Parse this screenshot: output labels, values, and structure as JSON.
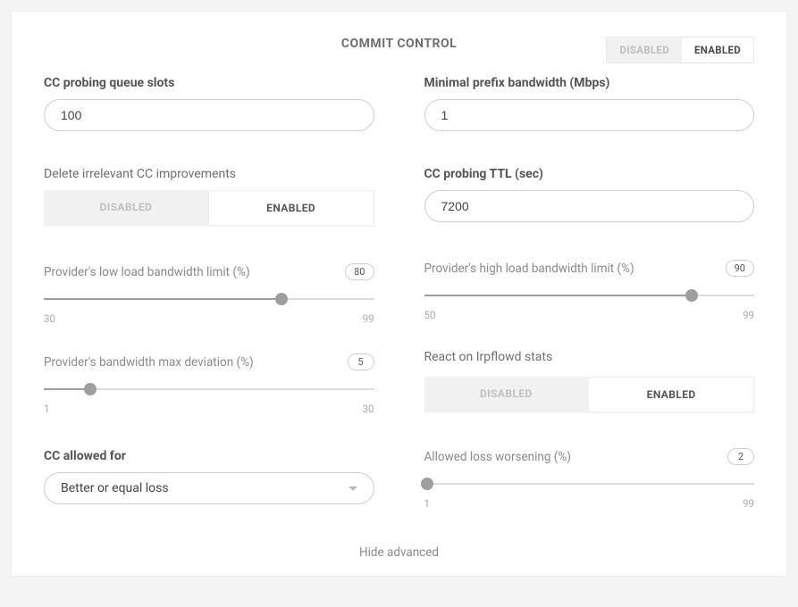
{
  "header": {
    "title": "COMMIT CONTROL",
    "master_toggle": {
      "off": "DISABLED",
      "on": "ENABLED"
    }
  },
  "left": {
    "queue_slots": {
      "label": "CC probing queue slots",
      "value": "100"
    },
    "delete_improvements": {
      "label": "Delete irrelevant CC improvements",
      "off": "DISABLED",
      "on": "ENABLED"
    },
    "low_load": {
      "label": "Provider's low load bandwidth limit (%)",
      "value": "80",
      "min": "30",
      "max": "99",
      "pct": 72
    },
    "deviation": {
      "label": "Provider's bandwidth max deviation (%)",
      "value": "5",
      "min": "1",
      "max": "30",
      "pct": 14
    },
    "cc_allowed": {
      "label": "CC allowed for",
      "selected": "Better or equal loss"
    }
  },
  "right": {
    "min_prefix": {
      "label": "Minimal prefix bandwidth (Mbps)",
      "value": "1"
    },
    "ttl": {
      "label": "CC probing TTL (sec)",
      "value": "7200"
    },
    "high_load": {
      "label": "Provider's high load bandwidth limit (%)",
      "value": "90",
      "min": "50",
      "max": "99",
      "pct": 81
    },
    "react": {
      "label": "React on Irpflowd stats",
      "off": "DISABLED",
      "on": "ENABLED"
    },
    "loss_worsening": {
      "label": "Allowed loss worsening (%)",
      "value": "2",
      "min": "1",
      "max": "99",
      "pct": 1
    }
  },
  "footer": {
    "hide": "Hide advanced"
  }
}
